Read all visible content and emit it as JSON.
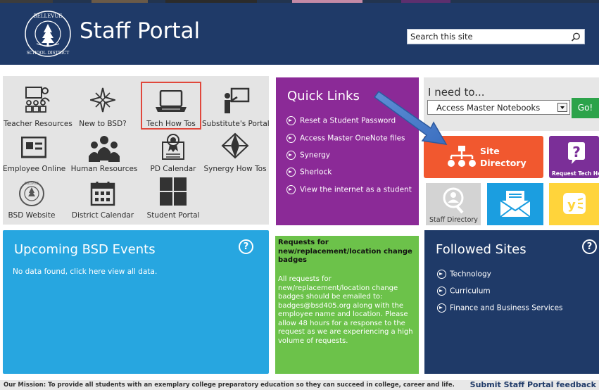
{
  "header": {
    "logo_text_top": "BELLEVUE",
    "logo_text_bottom": "SCHOOL DISTRICT",
    "title": "Staff Portal",
    "search_placeholder": "Search this site",
    "search_icon": "search-icon"
  },
  "tiles": [
    {
      "label": "Teacher Resources",
      "icon": "teacher-resources-icon"
    },
    {
      "label": "New to BSD?",
      "icon": "compass-star-icon"
    },
    {
      "label": "Tech How Tos",
      "icon": "laptop-icon"
    },
    {
      "label": "Substitute's Portal",
      "icon": "presenter-icon"
    },
    {
      "label": "Employee Online",
      "icon": "id-card-icon"
    },
    {
      "label": "Human Resources",
      "icon": "people-icon"
    },
    {
      "label": "PD Calendar",
      "icon": "certificate-icon"
    },
    {
      "label": "Synergy How Tos",
      "icon": "synergy-icon"
    },
    {
      "label": "BSD Website",
      "icon": "district-seal-icon"
    },
    {
      "label": "District Calendar",
      "icon": "calendar-icon"
    },
    {
      "label": "Student Portal",
      "icon": "windows-icon"
    }
  ],
  "quick_links": {
    "title": "Quick Links",
    "items": [
      "Reset a Student Password",
      "Access Master OneNote files",
      "Synergy",
      "Sherlock",
      "View the internet as a student"
    ]
  },
  "ineed": {
    "label": "I need to...",
    "selected": "Access Master Notebooks",
    "go_label": "Go!"
  },
  "site_directory": {
    "line1": "Site",
    "line2": "Directory"
  },
  "request_help": {
    "label": "Request Tech Help"
  },
  "staff_directory": {
    "label": "Staff Directory"
  },
  "events": {
    "title": "Upcoming BSD Events",
    "no_data": "No data found, click here view all data."
  },
  "badges": {
    "heading": "Requests for new/replacement/location change badges",
    "body": "All requests for new/replacement/location change badges should be emailed to: badges@bsd405.org along with the employee name and location. Please allow 48 hours for a response to the request as we are experiencing a high volume of requests."
  },
  "followed": {
    "title": "Followed Sites",
    "items": [
      "Technology",
      "Curriculum",
      "Finance and Business Services"
    ]
  },
  "footer": {
    "mission": "Our Mission: To provide all students with an exemplary college preparatory education so they can succeed in college, career and life.",
    "feedback": "Submit Staff Portal feedback"
  },
  "colors": {
    "header_bg": "#1f3a68",
    "quick_links_bg": "#8b2a97",
    "site_directory_bg": "#f1582f",
    "events_bg": "#27a6e0",
    "badges_bg": "#6cc24a",
    "go_button": "#2ca34a"
  }
}
